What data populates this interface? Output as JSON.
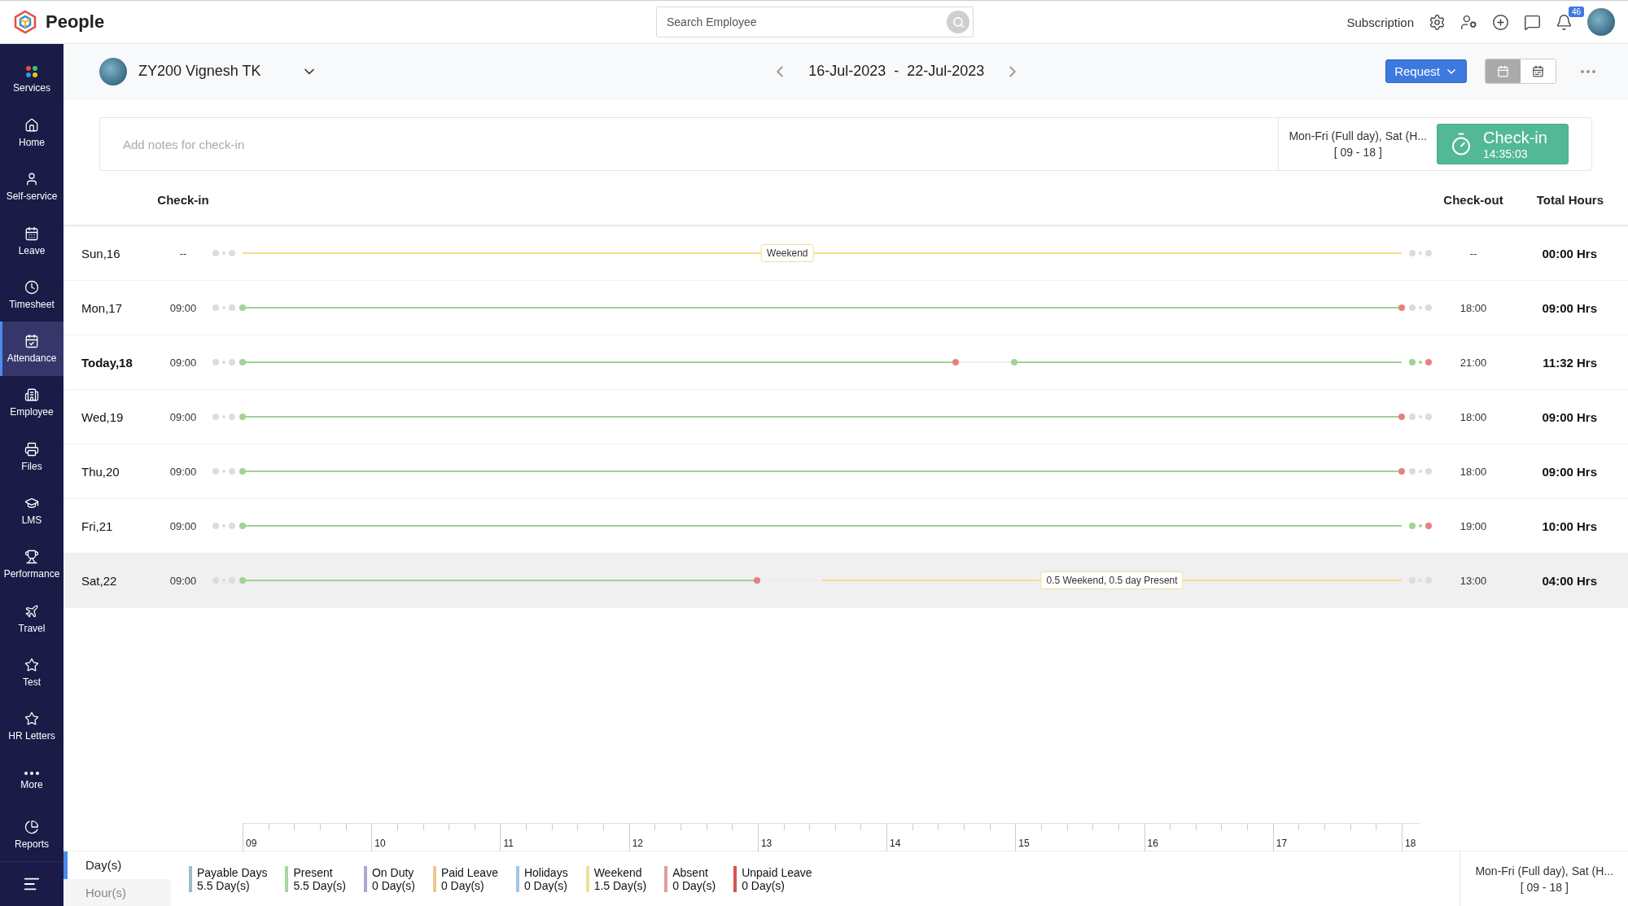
{
  "app": {
    "name": "People"
  },
  "search": {
    "placeholder": "Search Employee"
  },
  "top_actions": {
    "subscription": "Subscription",
    "notifications": "46"
  },
  "sidebar": {
    "items": [
      {
        "label": "Services",
        "selected": false
      },
      {
        "label": "Home",
        "selected": false
      },
      {
        "label": "Self-service",
        "selected": false
      },
      {
        "label": "Leave",
        "selected": false
      },
      {
        "label": "Timesheet",
        "selected": false
      },
      {
        "label": "Attendance",
        "selected": true
      },
      {
        "label": "Employee",
        "selected": false
      },
      {
        "label": "Files",
        "selected": false
      },
      {
        "label": "LMS",
        "selected": false
      },
      {
        "label": "Performance",
        "selected": false
      },
      {
        "label": "Travel",
        "selected": false
      },
      {
        "label": "Test",
        "selected": false
      },
      {
        "label": "HR Letters",
        "selected": false
      },
      {
        "label": "More",
        "selected": false
      }
    ],
    "bottom_items": [
      {
        "label": "Reports",
        "selected": false
      }
    ]
  },
  "header": {
    "employee": "ZY200 Vignesh TK",
    "date_range": "16-Jul-2023  -  22-Jul-2023",
    "request_button": "Request",
    "views": [
      {
        "selected": true
      },
      {
        "selected": false
      }
    ]
  },
  "notes": {
    "placeholder": "Add notes for check-in",
    "schedule": "Mon-Fri (Full day), Sat (H...",
    "schedule_hours": "[ 09 - 18 ]",
    "checkin_button": "Check-in",
    "checkin_timer": "14:35:03"
  },
  "table": {
    "columns": [
      "Check-in",
      "Check-out",
      "Total Hours"
    ],
    "rows": [
      {
        "day": "Sun,16",
        "check_in": "--",
        "kind": "weekend",
        "badge": "Weekend",
        "check_out": "--",
        "total": "00:00 Hrs",
        "current": false,
        "highlighted": false
      },
      {
        "day": "Mon,17",
        "check_in": "09:00",
        "kind": "full",
        "check_out": "18:00",
        "total": "09:00 Hrs",
        "current": false,
        "highlighted": false
      },
      {
        "day": "Today,18",
        "check_in": "09:00",
        "kind": "split",
        "check_out": "21:00",
        "total": "11:32 Hrs",
        "current": true,
        "highlighted": false
      },
      {
        "day": "Wed,19",
        "check_in": "09:00",
        "kind": "full",
        "check_out": "18:00",
        "total": "09:00 Hrs",
        "current": false,
        "highlighted": false
      },
      {
        "day": "Thu,20",
        "check_in": "09:00",
        "kind": "full",
        "check_out": "18:00",
        "total": "09:00 Hrs",
        "current": false,
        "highlighted": false
      },
      {
        "day": "Fri,21",
        "check_in": "09:00",
        "kind": "overtime",
        "check_out": "19:00",
        "total": "10:00 Hrs",
        "current": false,
        "highlighted": false
      },
      {
        "day": "Sat,22",
        "check_in": "09:00",
        "kind": "half",
        "badge": "0.5 Weekend, 0.5 day Present",
        "check_out": "13:00",
        "total": "04:00 Hrs",
        "current": false,
        "highlighted": true
      }
    ]
  },
  "axis": {
    "labels": [
      "09",
      "10",
      "11",
      "12",
      "13",
      "14",
      "15",
      "16",
      "17",
      "18"
    ]
  },
  "footer": {
    "tabs": [
      {
        "label": "Day(s)",
        "selected": true
      },
      {
        "label": "Hour(s)",
        "selected": false
      }
    ],
    "legend": [
      {
        "label": "Payable Days",
        "value": "5.5 Day(s)",
        "color": "#9dbcc8"
      },
      {
        "label": "Present",
        "value": "5.5 Day(s)",
        "color": "#a8d5a0"
      },
      {
        "label": "On Duty",
        "value": "0 Day(s)",
        "color": "#b1a4d4"
      },
      {
        "label": "Paid Leave",
        "value": "0 Day(s)",
        "color": "#f3c58f"
      },
      {
        "label": "Holidays",
        "value": "0 Day(s)",
        "color": "#a6c5e8"
      },
      {
        "label": "Weekend",
        "value": "1.5 Day(s)",
        "color": "#f3dd9c"
      },
      {
        "label": "Absent",
        "value": "0 Day(s)",
        "color": "#e79a9a"
      },
      {
        "label": "Unpaid Leave",
        "value": "0 Day(s)",
        "color": "#d9534f"
      }
    ],
    "schedule": "Mon-Fri (Full day), Sat (H...",
    "schedule_hours": "[ 09 - 18 ]"
  }
}
